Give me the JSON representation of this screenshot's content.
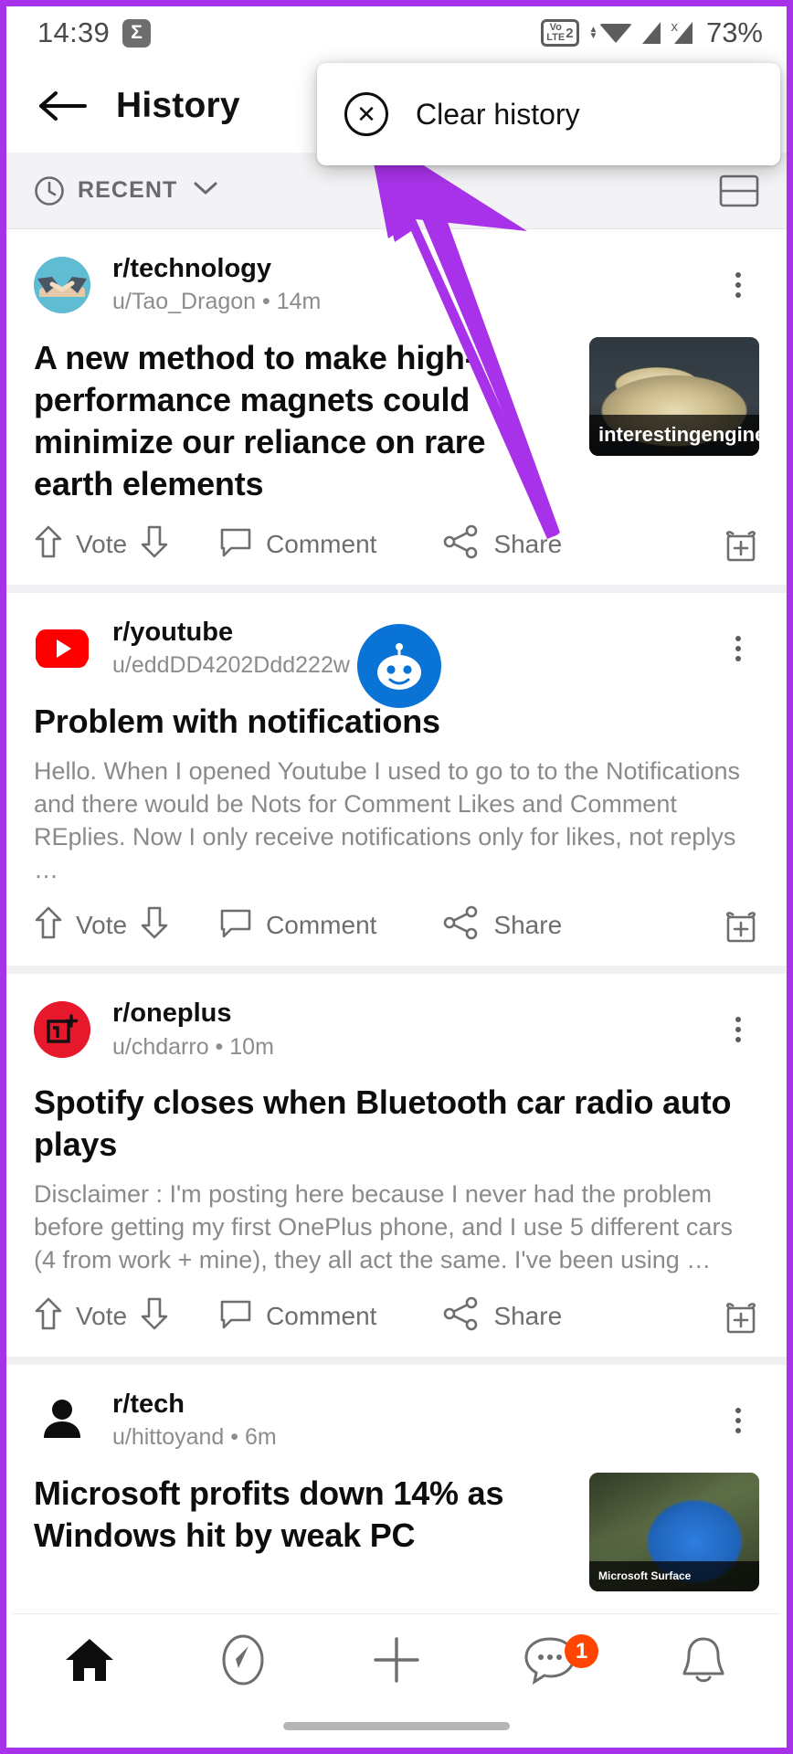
{
  "status_bar": {
    "time": "14:39",
    "sigma_icon": "sigma-badge-icon",
    "volte_top": "Vo",
    "volte_bottom": "LTE",
    "volte_sim": "2",
    "wifi_icon": "wifi-icon",
    "signal1_icon": "signal-bars-icon",
    "signal2_icon": "signal-bars-no-sim-icon",
    "signal2_mark": "x",
    "battery": "73%"
  },
  "app_bar": {
    "back_icon": "back-arrow-icon",
    "title": "History"
  },
  "popup_menu": {
    "icon": "close-circle-icon",
    "label": "Clear history"
  },
  "filter_bar": {
    "clock_icon": "clock-icon",
    "label": "RECENT",
    "chevron_icon": "chevron-down-icon",
    "layout_icon": "card-layout-icon"
  },
  "annotation": {
    "arrow_color": "#a832ea",
    "arrow_icon": "pointer-arrow-annotation"
  },
  "snoo_overlay": {
    "icon": "reddit-snoo-icon",
    "color": "#0a73d6"
  },
  "posts": [
    {
      "avatar_icon": "handshake-avatar-icon",
      "subreddit": "r/technology",
      "byline": "u/Tao_Dragon • 14m",
      "title": "A new method to make high-performance magnets could minimize our reliance on rare earth elements",
      "snippet": "",
      "thumbnail": {
        "icon": "rock-mineral-thumbnail",
        "caption": "interestingengine"
      },
      "actions": {
        "upvote_icon": "upvote-arrow-icon",
        "vote_label": "Vote",
        "downvote_icon": "downvote-arrow-icon",
        "comment_icon": "comment-bubble-icon",
        "comment_label": "Comment",
        "share_icon": "share-icon",
        "share_label": "Share",
        "award_icon": "award-gift-icon"
      }
    },
    {
      "avatar_icon": "youtube-avatar-icon",
      "subreddit": "r/youtube",
      "byline": "u/eddDD4202Ddd222w • 10m",
      "title": "Problem with notifications",
      "snippet": "Hello. When I opened Youtube I used to go to to the Notifications and there would be Nots for Comment Likes and Comment REplies. Now I only receive notifications only for likes, not replys …",
      "thumbnail": null,
      "actions": {
        "upvote_icon": "upvote-arrow-icon",
        "vote_label": "Vote",
        "downvote_icon": "downvote-arrow-icon",
        "comment_icon": "comment-bubble-icon",
        "comment_label": "Comment",
        "share_icon": "share-icon",
        "share_label": "Share",
        "award_icon": "award-gift-icon"
      }
    },
    {
      "avatar_icon": "oneplus-avatar-icon",
      "subreddit": "r/oneplus",
      "byline": "u/chdarro • 10m",
      "title": "Spotify closes when Bluetooth car radio auto plays",
      "snippet": "Disclaimer : I'm posting here because I never had the problem before getting my first OnePlus phone, and I use 5 different cars (4 from work + mine), they all act the same. I've been using …",
      "thumbnail": null,
      "actions": {
        "upvote_icon": "upvote-arrow-icon",
        "vote_label": "Vote",
        "downvote_icon": "downvote-arrow-icon",
        "comment_icon": "comment-bubble-icon",
        "comment_label": "Comment",
        "share_icon": "share-icon",
        "share_label": "Share",
        "award_icon": "award-gift-icon"
      }
    },
    {
      "avatar_icon": "person-avatar-icon",
      "subreddit": "r/tech",
      "byline": "u/hittoyand • 6m",
      "title": "Microsoft profits down 14% as Windows hit by weak PC",
      "snippet": "",
      "thumbnail": {
        "icon": "microsoft-surface-thumbnail",
        "caption": "Microsoft Surface"
      },
      "actions": null
    }
  ],
  "bottom_nav": {
    "items": [
      {
        "icon": "home-icon",
        "active": true
      },
      {
        "icon": "compass-explore-icon",
        "active": false
      },
      {
        "icon": "plus-create-icon",
        "active": false
      },
      {
        "icon": "chat-bubble-icon",
        "active": false,
        "badge": "1"
      },
      {
        "icon": "bell-notification-icon",
        "active": false
      }
    ],
    "badge_color": "#ff4500",
    "home_indicator": "home-indicator-bar"
  }
}
